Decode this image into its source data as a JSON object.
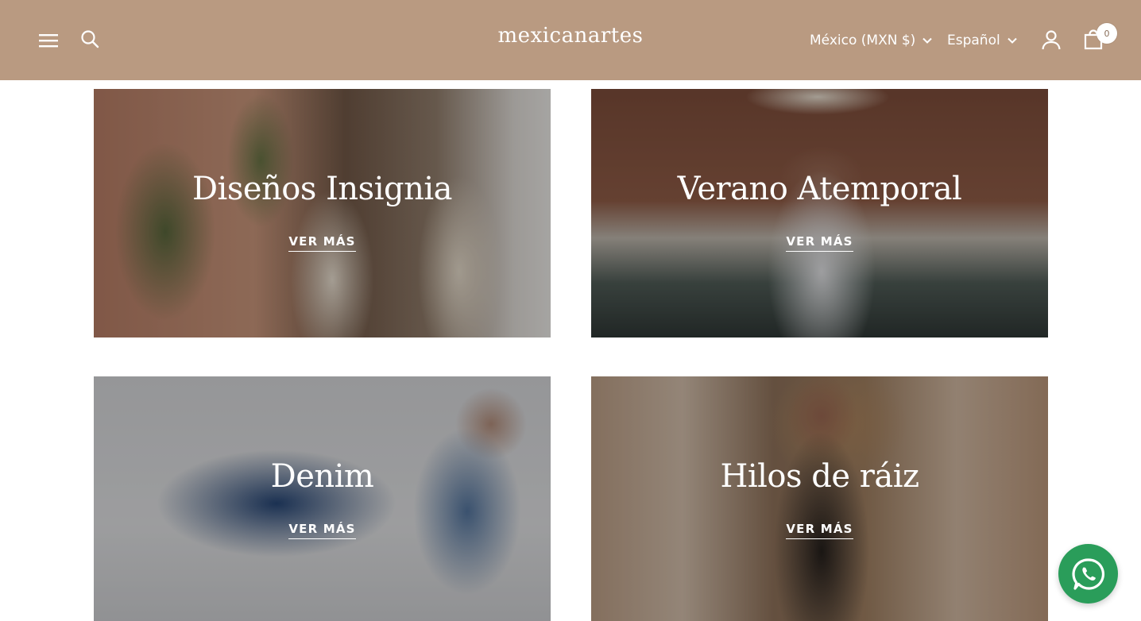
{
  "header": {
    "logo": "mexicanartes",
    "currency": "México (MXN $)",
    "language": "Español",
    "cart_count": "0",
    "background_color": "#b99a81"
  },
  "icons": {
    "menu": "hamburger-menu-icon",
    "search": "search-icon",
    "currency_chevron": "chevron-down-icon",
    "language_chevron": "chevron-down-icon",
    "account": "user-icon",
    "cart": "shopping-bag-icon",
    "whatsapp": "whatsapp-icon"
  },
  "collections": [
    {
      "title": "Diseños Insignia",
      "link": "VER MÁS"
    },
    {
      "title": "Verano Atemporal",
      "link": "VER MÁS"
    },
    {
      "title": "Denim",
      "link": "VER MÁS"
    },
    {
      "title": "Hilos de ráiz",
      "link": "VER MÁS"
    }
  ],
  "colors": {
    "whatsapp": "#2a9d5a",
    "text_on_image": "#ffffff"
  }
}
